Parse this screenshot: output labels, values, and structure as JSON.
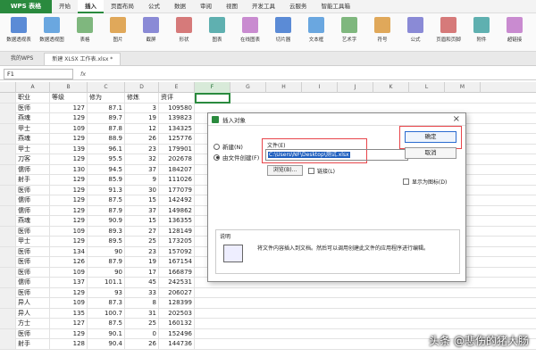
{
  "app": {
    "badge": "WPS 表格"
  },
  "ribbon": {
    "tabs": [
      "开始",
      "插入",
      "页面布局",
      "公式",
      "数据",
      "审阅",
      "视图",
      "开发工具",
      "云服务",
      "智能工具箱"
    ],
    "active_tab": "插入",
    "items": [
      "数据透视表",
      "数据透视图",
      "表格",
      "图片",
      "截屏",
      "形状",
      "图表",
      "在线图表",
      "切片器",
      "文本框",
      "艺术字",
      "符号",
      "公式",
      "页眉和页脚",
      "附件",
      "超链接"
    ]
  },
  "doc_tabs": {
    "items": [
      "我的WPS",
      "新建 XLSX 工作表.xlsx *"
    ],
    "active": 1
  },
  "formula_bar": {
    "name_box": "F1",
    "fx": "fx"
  },
  "sheet": {
    "columns": [
      "A",
      "B",
      "C",
      "D",
      "E",
      "F",
      "G",
      "H",
      "I",
      "J",
      "K",
      "L",
      "M"
    ],
    "selected_col": "F",
    "rows": [
      {
        "n": "1",
        "a": "职业",
        "b": "等级",
        "c": "修为",
        "d": "修炼",
        "e": "资评"
      },
      {
        "n": "2",
        "a": "医师",
        "b": "127",
        "c": "87.1",
        "d": "3",
        "e": "109580"
      },
      {
        "n": "3",
        "a": "燕魂",
        "b": "129",
        "c": "89.7",
        "d": "19",
        "e": "139823"
      },
      {
        "n": "4",
        "a": "甲士",
        "b": "109",
        "c": "87.8",
        "d": "12",
        "e": "134325"
      },
      {
        "n": "5",
        "a": "燕魂",
        "b": "129",
        "c": "88.9",
        "d": "26",
        "e": "125776"
      },
      {
        "n": "6",
        "a": "甲士",
        "b": "139",
        "c": "96.1",
        "d": "23",
        "e": "179901"
      },
      {
        "n": "7",
        "a": "刀客",
        "b": "129",
        "c": "95.5",
        "d": "32",
        "e": "202678"
      },
      {
        "n": "8",
        "a": "儒师",
        "b": "130",
        "c": "94.5",
        "d": "37",
        "e": "184207"
      },
      {
        "n": "9",
        "a": "射手",
        "b": "129",
        "c": "85.9",
        "d": "9",
        "e": "111026"
      },
      {
        "n": "10",
        "a": "医师",
        "b": "129",
        "c": "91.3",
        "d": "30",
        "e": "177079"
      },
      {
        "n": "11",
        "a": "儒师",
        "b": "129",
        "c": "87.5",
        "d": "15",
        "e": "142492"
      },
      {
        "n": "12",
        "a": "儒师",
        "b": "129",
        "c": "87.9",
        "d": "37",
        "e": "149862"
      },
      {
        "n": "13",
        "a": "燕魂",
        "b": "129",
        "c": "90.9",
        "d": "15",
        "e": "136355"
      },
      {
        "n": "14",
        "a": "医师",
        "b": "109",
        "c": "89.3",
        "d": "27",
        "e": "128149"
      },
      {
        "n": "15",
        "a": "甲士",
        "b": "129",
        "c": "89.5",
        "d": "25",
        "e": "173205"
      },
      {
        "n": "16",
        "a": "医师",
        "b": "134",
        "c": "90",
        "d": "23",
        "e": "157092"
      },
      {
        "n": "17",
        "a": "医师",
        "b": "126",
        "c": "87.9",
        "d": "19",
        "e": "167154"
      },
      {
        "n": "18",
        "a": "医师",
        "b": "109",
        "c": "90",
        "d": "17",
        "e": "166879"
      },
      {
        "n": "19",
        "a": "儒师",
        "b": "137",
        "c": "101.1",
        "d": "45",
        "e": "242531"
      },
      {
        "n": "20",
        "a": "医师",
        "b": "129",
        "c": "93",
        "d": "33",
        "e": "206027"
      },
      {
        "n": "21",
        "a": "异人",
        "b": "109",
        "c": "87.3",
        "d": "8",
        "e": "128399"
      },
      {
        "n": "22",
        "a": "异人",
        "b": "135",
        "c": "100.7",
        "d": "31",
        "e": "202503"
      },
      {
        "n": "23",
        "a": "方士",
        "b": "127",
        "c": "87.5",
        "d": "25",
        "e": "160132"
      },
      {
        "n": "24",
        "a": "医师",
        "b": "129",
        "c": "90.1",
        "d": "0",
        "e": "152496"
      },
      {
        "n": "25",
        "a": "射手",
        "b": "128",
        "c": "90.4",
        "d": "26",
        "e": "144736"
      }
    ]
  },
  "dialog": {
    "title": "插入对象",
    "close": "×",
    "radio_new": "新建(N)",
    "radio_from_file": "由文件创建(F)",
    "file_label": "文件(E)",
    "file_value": "C:\\Users\\NF\\Desktop\\测试.xlsx",
    "browse": "浏览(B)...",
    "link": "链接(L)",
    "ok": "确定",
    "cancel": "取消",
    "show_as_icon": "显示为图标(D)",
    "desc_title": "说明",
    "desc_text": "将文件内容插入到文档。然后可以调用创建此文件的应用程序进行编辑。"
  },
  "watermark": "头条 @悲伤的猪大肠",
  "colors": {
    "accent": "#2a8a3e",
    "highlight": "#e8454a"
  }
}
